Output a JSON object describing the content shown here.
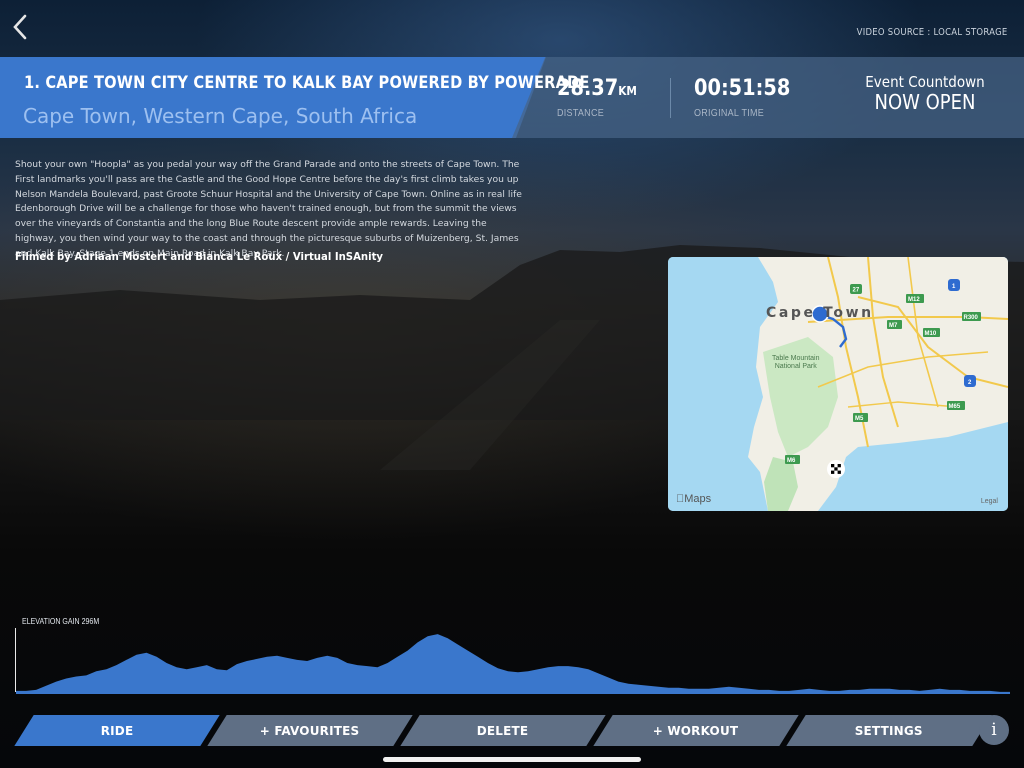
{
  "header": {
    "video_source": "VIDEO SOURCE : LOCAL STORAGE"
  },
  "route": {
    "title": "1. CAPE TOWN CITY CENTRE TO KALK BAY POWERED BY POWERADE",
    "location": "Cape Town, Western Cape, South Africa",
    "description": "Shout your own \"Hoopla\" as you pedal your way off the Grand Parade and onto the streets of Cape Town. The First landmarks you'll pass are the Castle and the Good Hope Centre before the day's first climb takes you up Nelson Mandela Boulevard, past Groote Schuur Hospital and the University of Cape Town. Online as in real life Edenborough Drive will be a challenge for those who haven't trained enough, but from the summit the views over the vineyards of Constantia and the long Blue Route descent provide ample rewards. Leaving the highway, you then wind your way to the coast and through the picturesque suburbs of Muizenberg, St. James and Kalk Bay. Stage 1 ends on Main Road in Kalk Bay Park.",
    "credits": "Filmed by Adriaan Mostert and Bianca Le Roux / Virtual InSAnity"
  },
  "stats": {
    "distance_value": "28.37",
    "distance_unit": "KM",
    "distance_label": "DISTANCE",
    "time_value": "00:51:58",
    "time_label": "ORIGINAL TIME",
    "countdown_title": "Event Countdown",
    "countdown_status": "NOW OPEN"
  },
  "map": {
    "city_label": "Cape Town",
    "park_label_1": "Table Mountain",
    "park_label_2": "National Park",
    "brand": "Maps",
    "legal": "Legal",
    "road_labels": [
      "27",
      "1",
      "M12",
      "M7",
      "M10",
      "R300",
      "2",
      "M5",
      "M65",
      "M6"
    ]
  },
  "elevation": {
    "label": "ELEVATION GAIN 296M",
    "profile": [
      3,
      3,
      4,
      8,
      12,
      15,
      17,
      18,
      22,
      24,
      28,
      33,
      38,
      40,
      36,
      30,
      26,
      24,
      26,
      28,
      24,
      23,
      29,
      32,
      34,
      36,
      37,
      35,
      33,
      32,
      35,
      37,
      35,
      30,
      28,
      27,
      26,
      30,
      36,
      42,
      50,
      56,
      58,
      54,
      48,
      42,
      36,
      30,
      25,
      22,
      21,
      22,
      24,
      26,
      27,
      27,
      26,
      24,
      20,
      16,
      12,
      10,
      9,
      8,
      7,
      6,
      6,
      5,
      5,
      5,
      6,
      7,
      6,
      5,
      4,
      4,
      3,
      3,
      4,
      5,
      4,
      3,
      3,
      4,
      4,
      5,
      5,
      5,
      4,
      4,
      3,
      4,
      5,
      4,
      4,
      3,
      3,
      3,
      2,
      2
    ]
  },
  "nav": {
    "ride": "RIDE",
    "favourites": "+ FAVOURITES",
    "delete": "DELETE",
    "workout": "+ WORKOUT",
    "settings": "SETTINGS",
    "info": "i"
  },
  "colors": {
    "accent": "#3a77cc",
    "button": "#5f6f85",
    "elevation_fill": "#3a77cc"
  }
}
